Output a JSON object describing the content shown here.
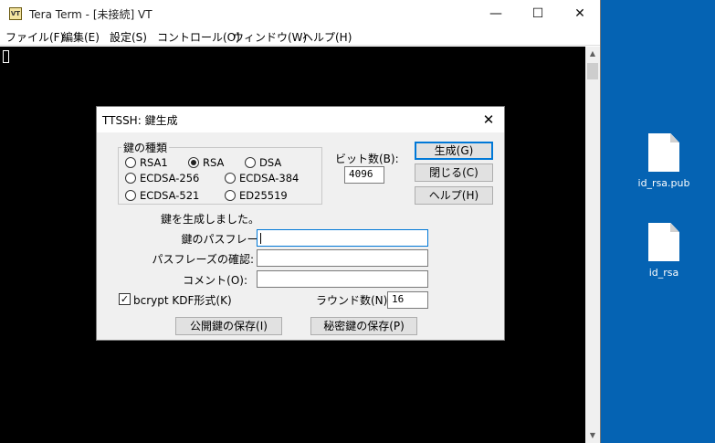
{
  "window": {
    "title": "Tera Term - [未接続] VT",
    "icon_text": "VT",
    "minimize": "—",
    "maximize": "☐",
    "close": "✕"
  },
  "menu": [
    "ファイル(F)",
    "編集(E)",
    "設定(S)",
    "コントロール(O)",
    "ウィンドウ(W)",
    "ヘルプ(H)"
  ],
  "scrollbar": {
    "up": "▲",
    "down": "▼"
  },
  "dialog": {
    "title": "TTSSH: 鍵生成",
    "close": "✕",
    "key_type_group": "鍵の種類",
    "radios": {
      "rsa1": "RSA1",
      "rsa": "RSA",
      "dsa": "DSA",
      "ecdsa256": "ECDSA-256",
      "ecdsa384": "ECDSA-384",
      "ecdsa521": "ECDSA-521",
      "ed25519": "ED25519"
    },
    "selected_key_type": "RSA",
    "bits_label": "ビット数(B):",
    "bits_value": "4096",
    "buttons": {
      "generate": "生成(G)",
      "close": "閉じる(C)",
      "help": "ヘルプ(H)",
      "save_public": "公開鍵の保存(I)",
      "save_private": "秘密鍵の保存(P)"
    },
    "status": "鍵を生成しました。",
    "passphrase_label": "鍵のパスフレーズ:",
    "passphrase_value": "",
    "confirm_label": "パスフレーズの確認:",
    "confirm_value": "",
    "comment_label": "コメント(O):",
    "comment_value": "",
    "bcrypt_label": "bcrypt KDF形式(K)",
    "bcrypt_checked": true,
    "bcrypt_mark": "✓",
    "rounds_label": "ラウンド数(N):",
    "rounds_value": "16"
  },
  "desktop": {
    "icons": [
      {
        "label": "id_rsa.pub"
      },
      {
        "label": "id_rsa"
      }
    ]
  }
}
